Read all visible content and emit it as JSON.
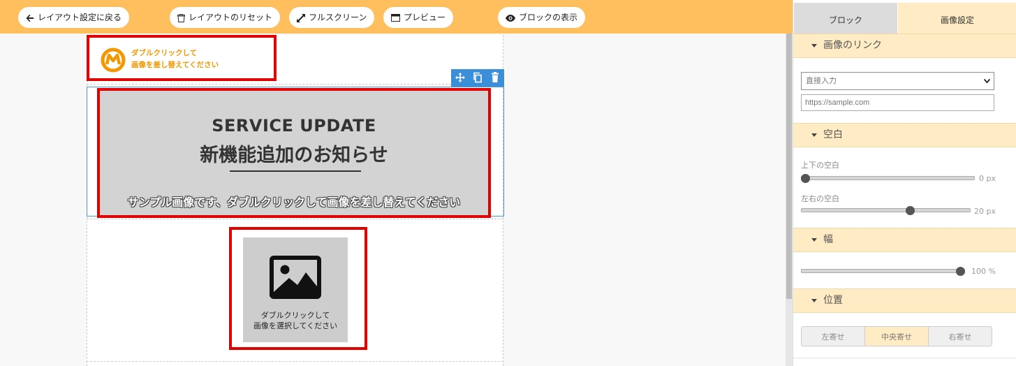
{
  "toolbar": {
    "back_label": "レイアウト設定に戻る",
    "reset_label": "レイアウトのリセット",
    "fullscreen_label": "フルスクリーン",
    "preview_label": "プレビュー",
    "show_blocks_label": "ブロックの表示"
  },
  "canvas": {
    "logo": {
      "line1": "ダブルクリックして",
      "line2": "画像を差し替えてください",
      "icon": "logo-mark"
    },
    "block_tools": [
      "move-icon",
      "copy-icon",
      "trash-icon"
    ],
    "banner": {
      "title_en": "SERVICE UPDATE",
      "title_jp": "新機能追加のお知らせ",
      "subtitle": "サンプル画像です、ダブルクリックして画像を差し替えてください"
    },
    "placeholder": {
      "line1": "ダブルクリックして",
      "line2": "画像を選択してください",
      "icon": "image-icon"
    }
  },
  "panel": {
    "tabs": {
      "block": "ブロック",
      "image_settings": "画像設定"
    },
    "link_section": {
      "title": "画像のリンク",
      "select_value": "直接入力",
      "url_placeholder": "https://sample.com"
    },
    "spacing_section": {
      "title": "空白",
      "vertical_label": "上下の空白",
      "vertical_value": "0",
      "vertical_fraction": 0.0,
      "horizontal_label": "左右の空白",
      "horizontal_value": "20",
      "horizontal_fraction": 0.65,
      "unit": "px"
    },
    "width_section": {
      "title": "幅",
      "value": "100",
      "fraction": 1.0,
      "unit": "%"
    },
    "position_section": {
      "title": "位置",
      "left": "左寄せ",
      "center": "中央寄せ",
      "right": "右寄せ",
      "selected": "center"
    }
  },
  "colors": {
    "toolbar_bg": "#ffbf5e",
    "accent_red": "#e10000",
    "section_bg": "#ffecc4",
    "selection_blue": "#3b8fd9",
    "logo_orange": "#f39800"
  }
}
